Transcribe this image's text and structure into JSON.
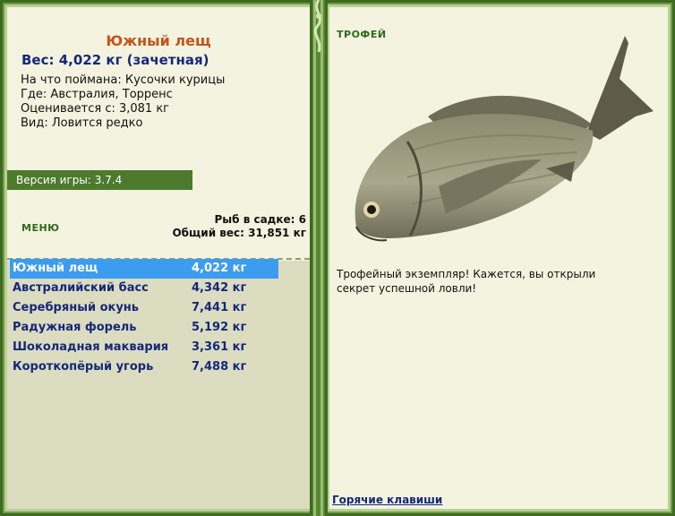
{
  "selected_fish": {
    "name": "Южный лещ",
    "weight_line": "Вес: 4,022 кг (зачетная)",
    "bait": "На что поймана: Кусочки курицы",
    "location": "Где: Австралия, Торренс",
    "value": "Оценивается с: 3,081 кг",
    "kind": "Вид: Ловится редко"
  },
  "version": "Версия игры: 3.7.4",
  "menu_label": "МЕНЮ",
  "stats": {
    "fish_in_keepnet": "Рыб в садке: 6",
    "total_weight": "Общий вес: 31,851 кг"
  },
  "fish_list": [
    {
      "name": "Южный лещ",
      "weight": "4,022 кг",
      "selected": true
    },
    {
      "name": "Австралийский басс",
      "weight": "4,342 кг",
      "selected": false
    },
    {
      "name": "Серебряный окунь",
      "weight": "7,441 кг",
      "selected": false
    },
    {
      "name": "Радужная форель",
      "weight": "5,192 кг",
      "selected": false
    },
    {
      "name": "Шоколадная маквария",
      "weight": "3,361 кг",
      "selected": false
    },
    {
      "name": "Короткопёрый угорь",
      "weight": "7,488 кг",
      "selected": false
    }
  ],
  "trophy": {
    "title": "ТРОФЕЙ",
    "message": "Трофейный экземпляр! Кажется, вы открыли секрет успешной ловли!"
  },
  "hotkeys_link": "Горячие клавиши",
  "colors": {
    "frame": "#4d7a2c",
    "panel": "#f4f3df",
    "selection": "#3c9cf0",
    "title": "#c5541a",
    "link": "#14287a"
  }
}
